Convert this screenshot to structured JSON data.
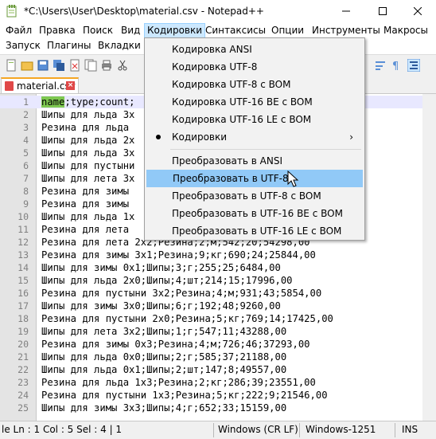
{
  "window": {
    "title": "*C:\\Users\\User\\Desktop\\material.csv - Notepad++",
    "min_icon": "minimize-icon",
    "max_icon": "maximize-icon",
    "close_icon": "close-icon"
  },
  "menubar": {
    "row1": [
      "Файл",
      "Правка",
      "Поиск",
      "Вид",
      "Кодировки",
      "Синтаксисы",
      "Опции",
      "Инструменты",
      "Макросы"
    ],
    "row2": [
      "Запуск",
      "Плагины",
      "Вкладки"
    ],
    "active": "Кодировки"
  },
  "tab": {
    "label": "material.csv",
    "close_icon": "tab-close-icon"
  },
  "editor": {
    "lines": [
      {
        "n": "1",
        "text": "name;type;count;"
      },
      {
        "n": "2",
        "text": "Шипы для льда 3x"
      },
      {
        "n": "3",
        "text": "Резина для льда "
      },
      {
        "n": "4",
        "text": "Шипы для льда 2x"
      },
      {
        "n": "5",
        "text": "Шипы для льда 3x"
      },
      {
        "n": "6",
        "text": "Шипы для пустыни"
      },
      {
        "n": "7",
        "text": "Шипы для лета 3x"
      },
      {
        "n": "8",
        "text": "Резина для зимы "
      },
      {
        "n": "9",
        "text": "Резина для зимы "
      },
      {
        "n": "10",
        "text": "Шипы для льда 1x"
      },
      {
        "n": "11",
        "text": "Резина для лета "
      },
      {
        "n": "12",
        "text": "Резина для лета 2x2;Резина;2;м;542;20;54298,00"
      },
      {
        "n": "13",
        "text": "Резина для зимы 3x1;Резина;9;кг;690;24;25844,00"
      },
      {
        "n": "14",
        "text": "Шипы для зимы 0x1;Шипы;3;г;255;25;6484,00"
      },
      {
        "n": "15",
        "text": "Шипы для льда 2x0;Шипы;4;шт;214;15;17996,00"
      },
      {
        "n": "16",
        "text": "Резина для пустыни 3x2;Резина;4;м;931;43;5854,00"
      },
      {
        "n": "17",
        "text": "Шипы для зимы 3x0;Шипы;6;г;192;48;9260,00"
      },
      {
        "n": "18",
        "text": "Резина для пустыни 2x0;Резина;5;кг;769;14;17425,00"
      },
      {
        "n": "19",
        "text": "Шипы для лета 3x2;Шипы;1;г;547;11;43288,00"
      },
      {
        "n": "20",
        "text": "Резина для зимы 0x3;Резина;4;м;726;46;37293,00"
      },
      {
        "n": "21",
        "text": "Шипы для льда 0x0;Шипы;2;г;585;37;21188,00"
      },
      {
        "n": "22",
        "text": "Шипы для льда 0x1;Шипы;2;шт;147;8;49557,00"
      },
      {
        "n": "23",
        "text": "Резина для льда 1x3;Резина;2;кг;286;39;23551,00"
      },
      {
        "n": "24",
        "text": "Резина для пустыни 1x3;Резина;5;кг;222;9;21546,00"
      },
      {
        "n": "25",
        "text": "Шипы для зимы 3x3;Шипы;4;г;652;33;15159,00"
      }
    ],
    "highlight_word": "name"
  },
  "dropdown": {
    "items": [
      {
        "label": "Кодировка ANSI"
      },
      {
        "label": "Кодировка UTF-8"
      },
      {
        "label": "Кодировка UTF-8 с BOM"
      },
      {
        "label": "Кодировка UTF-16 BE с BOM"
      },
      {
        "label": "Кодировка UTF-16 LE с BOM"
      },
      {
        "label": "Кодировки"
      },
      {
        "label": "Преобразовать в ANSI"
      },
      {
        "label": "Преобразовать в UTF-8"
      },
      {
        "label": "Преобразовать в UTF-8 с BOM"
      },
      {
        "label": "Преобразовать в UTF-16 BE с BOM"
      },
      {
        "label": "Преобразовать в UTF-16 LE с BOM"
      }
    ],
    "submenu_arrow": "›",
    "hovered": "Преобразовать в UTF-8"
  },
  "statusbar": {
    "pos": "le Ln : 1    Col : 5    Sel : 4 | 1",
    "eol": "Windows (CR LF)",
    "encoding": "Windows-1251",
    "mode": "INS"
  },
  "colors": {
    "menu_active": "#cce8ff",
    "item_hover": "#91c9f7",
    "word_highlight": "#7ec850",
    "tab_accent": "#f5a623"
  }
}
